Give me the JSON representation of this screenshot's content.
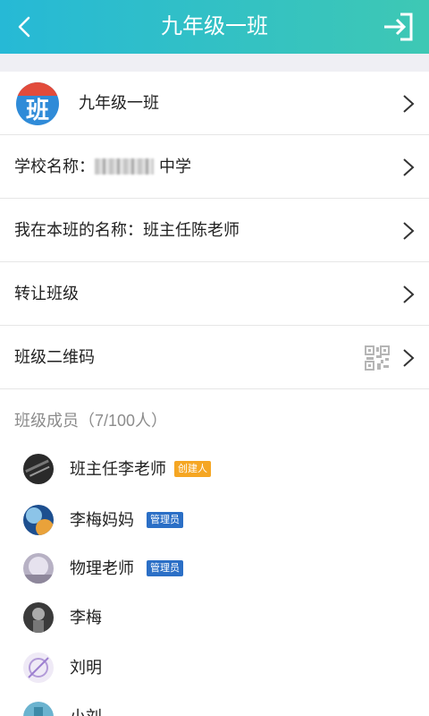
{
  "header": {
    "title": "九年级一班",
    "back_icon": "chevron-left-icon",
    "exit_icon": "exit-icon"
  },
  "class_info": {
    "name": "九年级一班",
    "logo_text": "班"
  },
  "school": {
    "prefix": "学校名称：",
    "suffix": "中学"
  },
  "my_name": {
    "label": "我在本班的名称：",
    "value": "班主任陈老师"
  },
  "transfer": {
    "label": "转让班级"
  },
  "qrcode": {
    "label": "班级二维码"
  },
  "members": {
    "header": "班级成员（7/100人）",
    "list": [
      {
        "name": "班主任李老师",
        "badge": "创建人",
        "badge_color": "#f5a623"
      },
      {
        "name": "李梅妈妈",
        "badge": "管理员",
        "badge_color": "#2b6fc6"
      },
      {
        "name": "物理老师",
        "badge": "管理员",
        "badge_color": "#2b6fc6"
      },
      {
        "name": "李梅"
      },
      {
        "name": "刘明"
      },
      {
        "name": "小刘"
      }
    ]
  },
  "colors": {
    "header_start": "#26b9d6",
    "header_end": "#3ec8b4",
    "creator": "#f5a623",
    "admin": "#2b6fc6"
  }
}
